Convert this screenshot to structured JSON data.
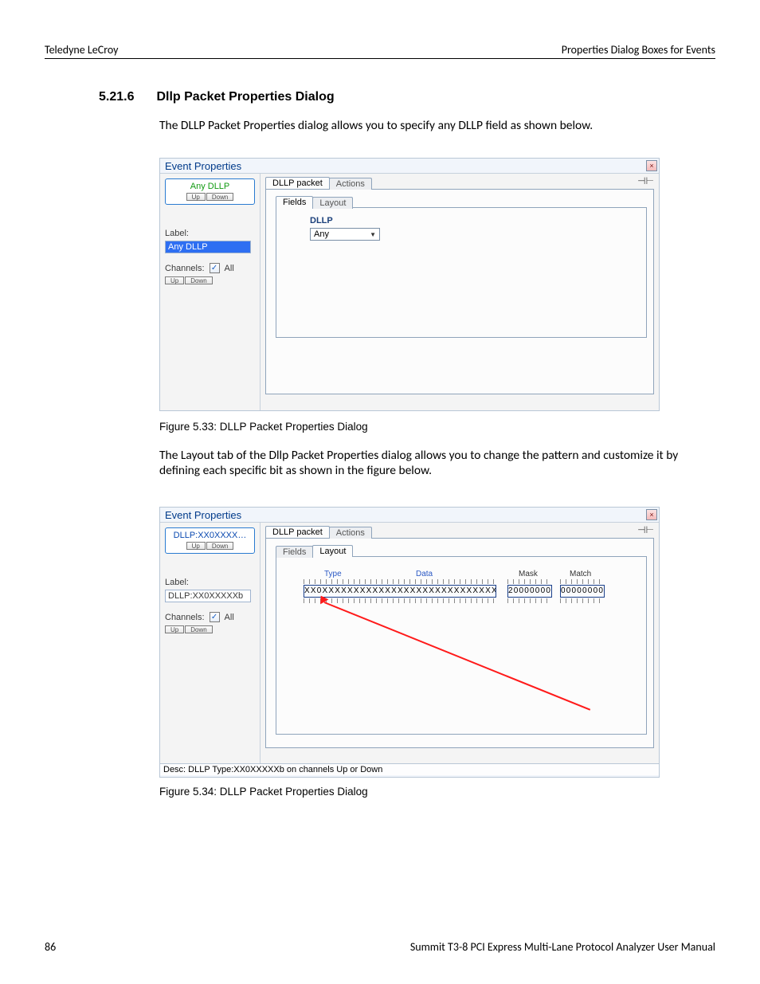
{
  "header": {
    "left": "Teledyne LeCroy",
    "right": "Properties Dialog Boxes for Events"
  },
  "section": {
    "number": "5.21.6",
    "title": "Dllp Packet Properties Dialog"
  },
  "intro": "The DLLP Packet Properties dialog allows you to specify any DLLP field as shown below.",
  "mid_paragraph": "The Layout tab of the Dllp Packet Properties dialog allows you to change the pattern and customize it by defining each specific bit as shown in the figure below.",
  "captions": {
    "fig1": "Figure 5.33:  DLLP Packet Properties Dialog",
    "fig2": "Figure 5.34:  DLLP Packet Properties Dialog"
  },
  "dialog_common": {
    "title": "Event Properties",
    "close_glyph": "×",
    "tab_packet": "DLLP packet",
    "tab_actions": "Actions",
    "subtab_fields": "Fields",
    "subtab_layout": "Layout",
    "up": "Up",
    "down": "Down",
    "label_label": "Label:",
    "channels_label": "Channels:",
    "all_label": "All",
    "check_glyph": "✓",
    "pin_glyph": "⊣⊢"
  },
  "dlg1": {
    "event_name": "Any DLLP",
    "label_value": "Any DLLP",
    "dllp_heading": "DLLP",
    "combo_value": "Any"
  },
  "dlg2": {
    "event_name": "DLLP:XX0XXXX…",
    "label_value": "DLLP:XX0XXXXXb",
    "type_label": "Type",
    "data_label": "Data",
    "mask_label": "Mask",
    "match_label": "Match",
    "typedata_bits": "XX0XXXXXXXXXXXXXXXXXXXXXXXXXXXXX",
    "mask_bits": "20000000",
    "match_bits": "00000000",
    "desc_bar": "Desc: DLLP Type:XX0XXXXXb on channels Up or Down"
  },
  "footer": {
    "page": "86",
    "manual": "Summit T3-8 PCI Express Multi-Lane Protocol Analyzer User Manual"
  }
}
